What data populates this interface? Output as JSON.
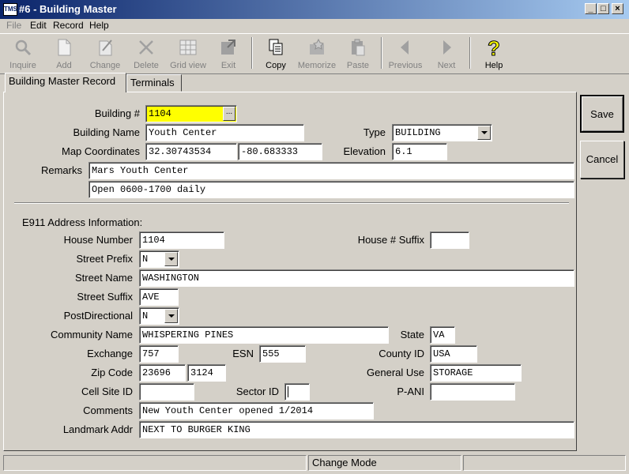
{
  "window": {
    "title": "#6 - Building Master",
    "app_icon": "TMS"
  },
  "menu": [
    "File",
    "Edit",
    "Record",
    "Help"
  ],
  "toolbar": [
    {
      "label": "Inquire",
      "icon": "magnifier-icon",
      "enabled": false
    },
    {
      "label": "Add",
      "icon": "new-page-icon",
      "enabled": false
    },
    {
      "label": "Change",
      "icon": "edit-page-icon",
      "enabled": false
    },
    {
      "label": "Delete",
      "icon": "x-delete-icon",
      "enabled": false
    },
    {
      "label": "Grid view",
      "icon": "grid-icon",
      "enabled": false
    },
    {
      "label": "Exit",
      "icon": "exit-icon",
      "enabled": false
    },
    {
      "label": "Copy",
      "icon": "copy-icon",
      "enabled": true
    },
    {
      "label": "Memorize",
      "icon": "memorize-icon",
      "enabled": false
    },
    {
      "label": "Paste",
      "icon": "paste-icon",
      "enabled": false
    },
    {
      "label": "Previous",
      "icon": "arrow-left-icon",
      "enabled": false
    },
    {
      "label": "Next",
      "icon": "arrow-right-icon",
      "enabled": false
    },
    {
      "label": "Help",
      "icon": "question-icon",
      "enabled": true
    }
  ],
  "tabs": {
    "record": "Building Master Record",
    "terminals": "Terminals"
  },
  "form": {
    "building_no_label": "Building #",
    "building_no": "1104",
    "building_name_label": "Building Name",
    "building_name": "Youth Center",
    "type_label": "Type",
    "type": "BUILDING",
    "map_label": "Map Coordinates",
    "lat": "32.30743534",
    "lon": "-80.683333",
    "elevation_label": "Elevation",
    "elevation": "6.1",
    "remarks_label": "Remarks",
    "remarks1": "Mars Youth Center",
    "remarks2": "Open 0600-1700 daily",
    "e911_header": "E911 Address Information:",
    "house_number_label": "House Number",
    "house_number": "1104",
    "house_suffix_label": "House # Suffix",
    "house_suffix": "",
    "street_prefix_label": "Street Prefix",
    "street_prefix": "N",
    "street_name_label": "Street Name",
    "street_name": "WASHINGTON",
    "street_suffix_label": "Street Suffix",
    "street_suffix": "AVE",
    "postdir_label": "PostDirectional",
    "postdir": "N",
    "community_label": "Community Name",
    "community": "WHISPERING PINES",
    "state_label": "State",
    "state": "VA",
    "exchange_label": "Exchange",
    "exchange": "757",
    "esn_label": "ESN",
    "esn": "555",
    "county_label": "County ID",
    "county": "USA",
    "zip_label": "Zip Code",
    "zip": "23696",
    "zip4": "3124",
    "general_use_label": "General Use",
    "general_use": "STORAGE",
    "cell_site_label": "Cell Site ID",
    "cell_site": "",
    "sector_label": "Sector ID",
    "sector": "",
    "pani_label": "P-ANI",
    "pani": "",
    "comments_label": "Comments",
    "comments": "New Youth Center opened 1/2014",
    "landmark_label": "Landmark Addr",
    "landmark": "NEXT TO BURGER KING"
  },
  "buttons": {
    "save": "Save",
    "cancel": "Cancel"
  },
  "status": {
    "mode": "Change Mode"
  }
}
